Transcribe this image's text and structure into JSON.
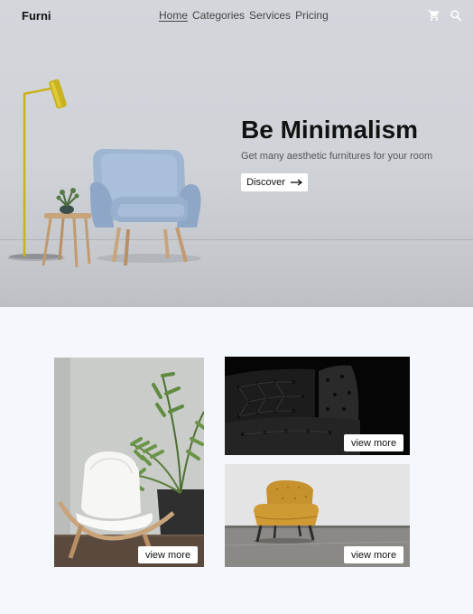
{
  "brand": "Furni",
  "nav": {
    "items": [
      "Home",
      "Categories",
      "Services",
      "Pricing"
    ],
    "active_index": 0
  },
  "icons": {
    "cart": "cart-icon",
    "search": "search-icon",
    "arrow": "arrow-right-icon"
  },
  "hero": {
    "title": "Be Minimalism",
    "subtitle": "Get many aesthetic furnitures for your room",
    "cta_label": "Discover"
  },
  "gallery": {
    "cards": [
      {
        "subject": "white chair with palm plant",
        "button_label": "view more"
      },
      {
        "subject": "black tufted leather sofa",
        "button_label": "view more"
      },
      {
        "subject": "mustard armchair",
        "button_label": "view more"
      }
    ]
  },
  "colors": {
    "page_bg": "#f4f8fc",
    "chair_blue": "#9fb6d3",
    "lamp_gold": "#c9b21d",
    "mustard": "#c7922d"
  }
}
